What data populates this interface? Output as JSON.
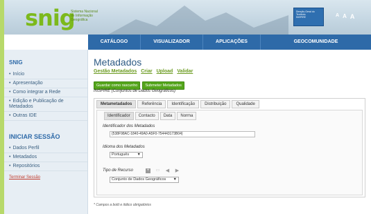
{
  "header": {
    "logo_text": "snig",
    "logo_sub": [
      "Sistema Nacional",
      "de Informação",
      "Geográfica"
    ],
    "badge_lines": [
      "Direção-Geral do",
      "Território",
      "INSPIRE"
    ],
    "font_sizes": [
      "A",
      "A",
      "A"
    ]
  },
  "nav": [
    {
      "label": "CATÁLOGO"
    },
    {
      "label": "VISUALIZADOR"
    },
    {
      "label": "APLICAÇÕES"
    },
    {
      "label": "GEOCOMUNIDADE"
    }
  ],
  "sidebar": {
    "snig_title": "SNIG",
    "snig_items": [
      "Início",
      "Apresentação",
      "Como integrar a Rede",
      "Edição e Publicação de Metadados",
      "Outras IDE"
    ],
    "session_title": "INICIAR SESSÃO",
    "session_items": [
      "Dados Perfil",
      "Metadados",
      "Repositórios"
    ],
    "logout": "Terminar Sessão"
  },
  "main": {
    "title": "Metadados",
    "submenu": [
      "Gestão Metadados",
      "Criar",
      "Upload",
      "Validar"
    ],
    "buttons": [
      "Guardar como rascunho",
      "Submeter Metadados"
    ],
    "inspire_label": "INSPIRE (Conjuntos de Dados Geográficos)",
    "outer_tabs": [
      "Metametadados",
      "Referência",
      "Identificação",
      "Distribuição",
      "Qualidade"
    ],
    "inner_tabs": [
      "Identificador",
      "Contacto",
      "Data",
      "Norma"
    ],
    "identifier_label": "Identificador dos Metadados",
    "identifier_value": "{538F98AC-1840-49A0-A5F0-754443173B04}",
    "language_label": "Idioma dos Metadados",
    "language_value": "Português",
    "resource_label": "Tipo de Recurso",
    "resource_value": "Conjunto de Dados Geográficos",
    "footnote": "* Campos a bold e itálico obrigatórios"
  }
}
